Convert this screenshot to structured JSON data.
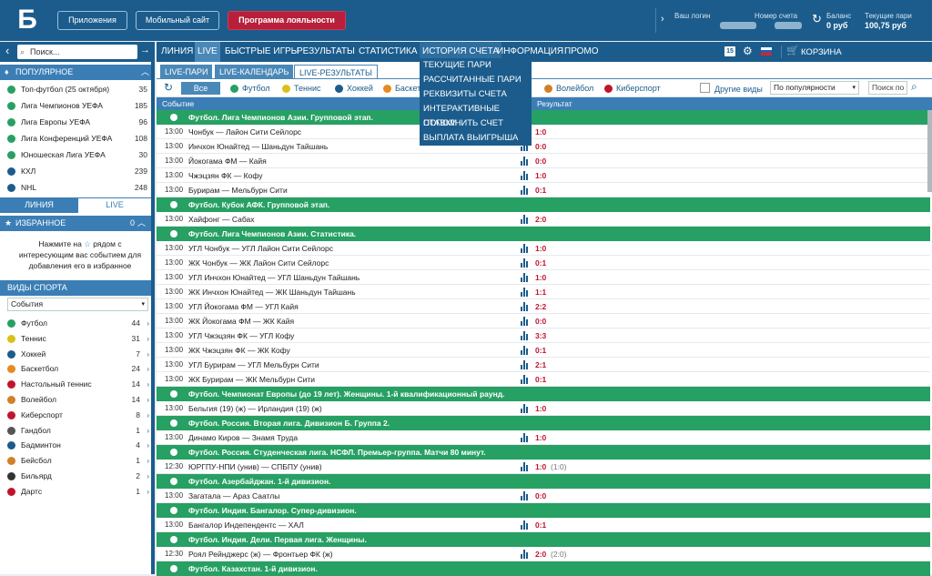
{
  "header": {
    "logo": "Б",
    "buttons": [
      "Приложения",
      "Мобильный сайт",
      "Программа лояльности"
    ],
    "account": {
      "login_label": "Ваш логин",
      "account_label": "Номер счета",
      "balance_label": "Баланс",
      "balance_value": "0 руб",
      "bets_label": "Текущие пари",
      "bets_value": "100,75 руб"
    }
  },
  "search": {
    "placeholder": "Поиск..."
  },
  "nav": {
    "items": [
      "ЛИНИЯ",
      "LIVE",
      "БЫСТРЫЕ ИГРЫ",
      "РЕЗУЛЬТАТЫ",
      "СТАТИСТИКА",
      "ИСТОРИЯ СЧЕТА",
      "ИНФОРМАЦИЯ",
      "ПРОМО"
    ],
    "badge": "15",
    "cart": "КОРЗИНА"
  },
  "history_menu": [
    "ТЕКУЩИЕ ПАРИ",
    "РАССЧИТАННЫЕ ПАРИ",
    "РЕКВИЗИТЫ СЧЕТА",
    "ИНТЕРАКТИВНЫЕ СТАВКИ",
    "ПОПОЛНИТЬ СЧЕТ",
    "ВЫПЛАТА ВЫИГРЫША"
  ],
  "popular": {
    "title": "ПОПУЛЯРНОЕ",
    "items": [
      {
        "label": "Топ-футбол (25 октября)",
        "count": "35"
      },
      {
        "label": "Лига Чемпионов УЕФА",
        "count": "185"
      },
      {
        "label": "Лига Европы УЕФА",
        "count": "96"
      },
      {
        "label": "Лига Конференций УЕФА",
        "count": "108"
      },
      {
        "label": "Юношеская Лига УЕФА",
        "count": "30"
      },
      {
        "label": "КХЛ",
        "count": "239"
      },
      {
        "label": "NHL",
        "count": "248"
      }
    ]
  },
  "side_tabs": [
    "ЛИНИЯ",
    "LIVE"
  ],
  "favorites": {
    "title": "ИЗБРАННОЕ",
    "count": "0",
    "hint_1": "Нажмите на",
    "hint_2": "рядом с интересующим вас событием для добавления его в избранное"
  },
  "sports": {
    "title": "ВИДЫ СПОРТА",
    "select": "События",
    "items": [
      {
        "label": "Футбол",
        "count": "44",
        "color": "#27a063"
      },
      {
        "label": "Теннис",
        "count": "31",
        "color": "#d8c21a"
      },
      {
        "label": "Хоккей",
        "count": "7",
        "color": "#1b5c8c"
      },
      {
        "label": "Баскетбол",
        "count": "24",
        "color": "#e58a1e"
      },
      {
        "label": "Настольный теннис",
        "count": "14",
        "color": "#c0142d"
      },
      {
        "label": "Волейбол",
        "count": "14",
        "color": "#d0802a"
      },
      {
        "label": "Киберспорт",
        "count": "8",
        "color": "#c0142d"
      },
      {
        "label": "Гандбол",
        "count": "1",
        "color": "#555"
      },
      {
        "label": "Бадминтон",
        "count": "4",
        "color": "#1b5c8c"
      },
      {
        "label": "Бейсбол",
        "count": "1",
        "color": "#d0802a"
      },
      {
        "label": "Бильярд",
        "count": "2",
        "color": "#333"
      },
      {
        "label": "Дартс",
        "count": "1",
        "color": "#c0142d"
      }
    ]
  },
  "subtabs": [
    "LIVE-ПАРИ",
    "LIVE-КАЛЕНДАРЬ",
    "LIVE-РЕЗУЛЬТАТЫ"
  ],
  "filters": {
    "all": "Все",
    "sports": [
      "Футбол",
      "Теннис",
      "Хоккей",
      "Баскетбол",
      "Волейбол",
      "Киберспорт"
    ],
    "other": "Другие виды",
    "sort": "По популярности",
    "search": "Поиск по"
  },
  "table": {
    "col_event": "Событие",
    "col_result": "Результат",
    "rows": [
      {
        "group": "Футбол. Лига Чемпионов Азии. Групповой этап."
      },
      {
        "time": "13:00",
        "event": "Чонбук — Лайон Сити Сейлорс",
        "score": "1:0"
      },
      {
        "time": "13:00",
        "event": "Инчхон Юнайтед — Шаньдун Тайшань",
        "score": "0:0"
      },
      {
        "time": "13:00",
        "event": "Йокогама ФМ — Кайя",
        "score": "0:0"
      },
      {
        "time": "13:00",
        "event": "Чжэцзян ФК — Кофу",
        "score": "1:0"
      },
      {
        "time": "13:00",
        "event": "Бурирам — Мельбурн Сити",
        "score": "0:1"
      },
      {
        "group": "Футбол. Кубок АФК. Групповой этап."
      },
      {
        "time": "13:00",
        "event": "Хайфонг — Сабах",
        "score": "2:0"
      },
      {
        "group": "Футбол. Лига Чемпионов Азии. Статистика."
      },
      {
        "time": "13:00",
        "event": "УГЛ Чонбук — УГЛ Лайон Сити Сейлорс",
        "score": "1:0"
      },
      {
        "time": "13:00",
        "event": "ЖК Чонбук — ЖК Лайон Сити Сейлорс",
        "score": "0:1"
      },
      {
        "time": "13:00",
        "event": "УГЛ Инчхон Юнайтед — УГЛ Шаньдун Тайшань",
        "score": "1:0"
      },
      {
        "time": "13:00",
        "event": "ЖК Инчхон Юнайтед — ЖК Шаньдун Тайшань",
        "score": "1:1"
      },
      {
        "time": "13:00",
        "event": "УГЛ Йокогама ФМ — УГЛ Кайя",
        "score": "2:2"
      },
      {
        "time": "13:00",
        "event": "ЖК Йокогама ФМ — ЖК Кайя",
        "score": "0:0"
      },
      {
        "time": "13:00",
        "event": "УГЛ Чжэцзян ФК — УГЛ Кофу",
        "score": "3:3"
      },
      {
        "time": "13:00",
        "event": "ЖК Чжэцзян ФК — ЖК Кофу",
        "score": "0:1"
      },
      {
        "time": "13:00",
        "event": "УГЛ Бурирам — УГЛ Мельбурн Сити",
        "score": "2:1"
      },
      {
        "time": "13:00",
        "event": "ЖК Бурирам — ЖК Мельбурн Сити",
        "score": "0:1"
      },
      {
        "group": "Футбол. Чемпионат Европы (до 19 лет). Женщины. 1-й квалификационный раунд."
      },
      {
        "time": "13:00",
        "event": "Бельгия (19) (ж) — Ирландия (19) (ж)",
        "score": "1:0"
      },
      {
        "group": "Футбол. Россия. Вторая лига. Дивизион Б. Группа 2."
      },
      {
        "time": "13:00",
        "event": "Динамо Киров — Знамя Труда",
        "score": "1:0"
      },
      {
        "group": "Футбол. Россия. Студенческая лига. НСФЛ. Премьер-группа. Матчи 80 минут."
      },
      {
        "time": "12:30",
        "event": "ЮРГПУ-НПИ (унив) — СПБПУ (унив)",
        "score": "1:0",
        "extra": "(1:0)"
      },
      {
        "group": "Футбол. Азербайджан. 1-й дивизион."
      },
      {
        "time": "13:00",
        "event": "Загатала — Араз Саатлы",
        "score": "0:0"
      },
      {
        "group": "Футбол. Индия. Бангалор. Супер-дивизион."
      },
      {
        "time": "13:00",
        "event": "Бангалор Индепендентс — ХАЛ",
        "score": "0:1"
      },
      {
        "group": "Футбол. Индия. Дели. Первая лига. Женщины."
      },
      {
        "time": "12:30",
        "event": "Роял Рейнджерс (ж) — Фронтьер ФК (ж)",
        "score": "2:0",
        "extra": "(2:0)"
      },
      {
        "group": "Футбол. Казахстан. 1-й дивизион."
      }
    ]
  }
}
